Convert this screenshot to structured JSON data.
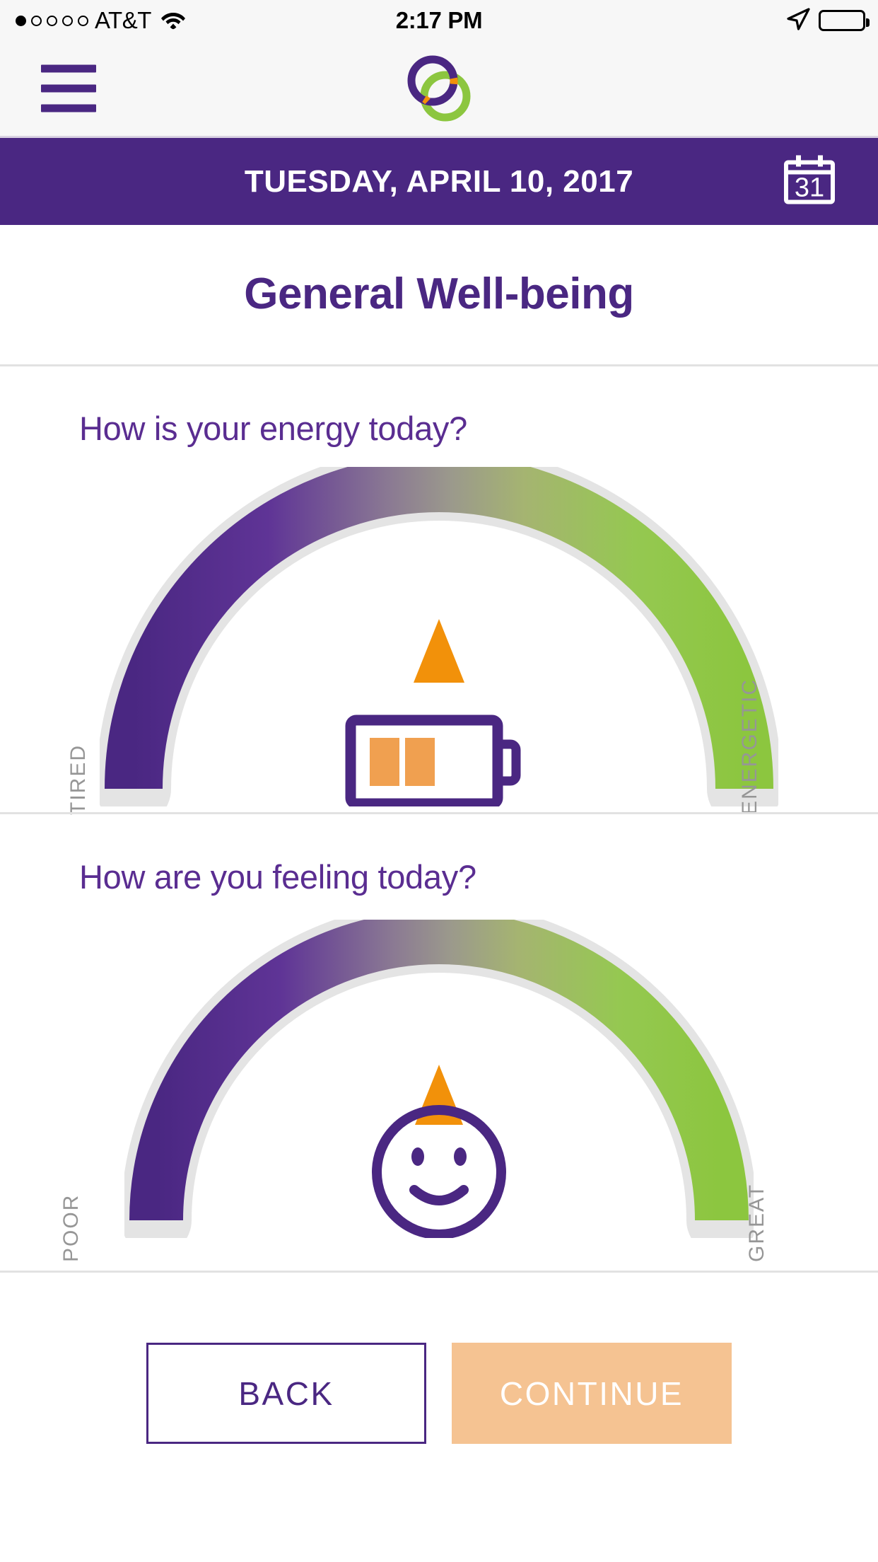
{
  "status_bar": {
    "signal_dots_total": 5,
    "signal_dots_filled": 1,
    "carrier": "AT&T",
    "wifi_icon": "wifi-icon",
    "time": "2:17 PM",
    "location_icon": "location-arrow-icon",
    "battery_icon": "battery-full-icon"
  },
  "header": {
    "menu_icon": "hamburger-menu-icon",
    "logo_icon": "interlocking-rings-logo"
  },
  "date_bar": {
    "date": "TUESDAY, APRIL 10, 2017",
    "calendar_icon": "calendar-icon",
    "calendar_day": "31",
    "background_color": "#4a2782"
  },
  "page": {
    "title": "General Well-being"
  },
  "questions": [
    {
      "text": "How is your energy today?",
      "gauge": {
        "label_left": "TIRED",
        "label_right": "ENERGETIC",
        "marker_icon": "orange-triangle-marker",
        "marker_position_percent": 55,
        "center_icon": "battery-half-icon",
        "gradient_start": "#5a2d91",
        "gradient_mid": "#9a9a8a",
        "gradient_end": "#8cc63f",
        "track_color": "#e4e4e4",
        "marker_color": "#f2910a"
      }
    },
    {
      "text": "How are you feeling today?",
      "gauge": {
        "label_left": "POOR",
        "label_right": "GREAT",
        "marker_icon": "orange-triangle-marker",
        "marker_position_percent": 53,
        "center_icon": "smiley-face-icon",
        "gradient_start": "#5a2d91",
        "gradient_mid": "#9a9a8a",
        "gradient_end": "#8cc63f",
        "track_color": "#e4e4e4",
        "marker_color": "#f2910a"
      }
    }
  ],
  "footer": {
    "back_label": "BACK",
    "continue_label": "CONTINUE",
    "back_color": "#4a2782",
    "continue_color": "#f5c392"
  }
}
